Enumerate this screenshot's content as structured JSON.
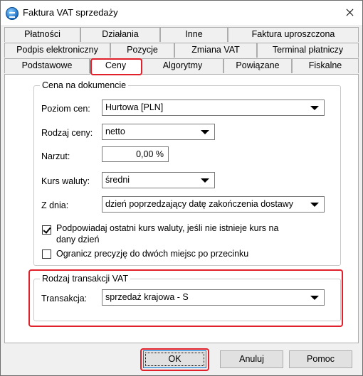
{
  "window": {
    "title": "Faktura VAT sprzedaży"
  },
  "tabs": {
    "row1": [
      "Płatności",
      "Działania",
      "Inne",
      "Faktura uproszczona"
    ],
    "row2": [
      "Podpis elektroniczny",
      "Pozycje",
      "Zmiana VAT",
      "Terminal płatniczy"
    ],
    "row3": [
      "Podstawowe",
      "Ceny",
      "Algorytmy",
      "Powiązane",
      "Fiskalne"
    ],
    "active": "Ceny"
  },
  "price_group": {
    "title": "Cena na dokumencie",
    "price_level": {
      "label": "Poziom cen:",
      "value": "Hurtowa [PLN]"
    },
    "price_type": {
      "label": "Rodzaj ceny:",
      "value": "netto"
    },
    "markup": {
      "label": "Narzut:",
      "value": "0,00 %"
    },
    "exchange_rate": {
      "label": "Kurs waluty:",
      "value": "średni"
    },
    "from_day": {
      "label": "Z dnia:",
      "value": "dzień poprzedzający datę zakończenia dostawy"
    },
    "suggest_last_rate": {
      "label": "Podpowiadaj ostatni kurs waluty, jeśli nie istnieje kurs na dany dzień",
      "checked": true
    },
    "limit_precision": {
      "label": "Ogranicz precyzję do dwóch miejsc po przecinku",
      "checked": false
    }
  },
  "vat_group": {
    "title": "Rodzaj transakcji VAT",
    "transaction": {
      "label": "Transakcja:",
      "value": "sprzedaż krajowa - S"
    }
  },
  "buttons": {
    "ok": "OK",
    "cancel": "Anuluj",
    "help": "Pomoc"
  },
  "colors": {
    "highlight": "#e0202a",
    "focus_border": "#0078d7"
  }
}
